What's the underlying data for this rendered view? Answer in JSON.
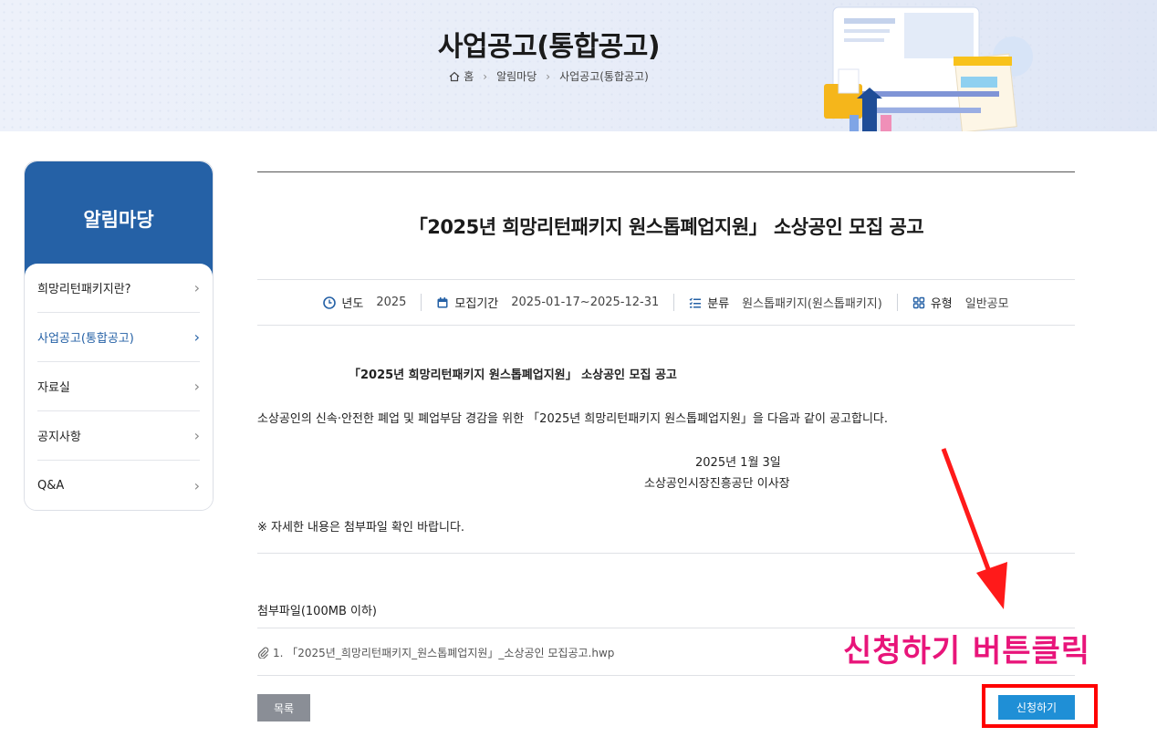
{
  "header": {
    "title": "사업공고(통합공고)",
    "breadcrumb": [
      "홈",
      "알림마당",
      "사업공고(통합공고)"
    ]
  },
  "sidebar": {
    "title": "알림마당",
    "items": [
      {
        "label": "희망리턴패키지란?",
        "active": false
      },
      {
        "label": "사업공고(통합공고)",
        "active": true
      },
      {
        "label": "자료실",
        "active": false
      },
      {
        "label": "공지사항",
        "active": false
      },
      {
        "label": "Q&A",
        "active": false
      }
    ]
  },
  "article": {
    "title": "「2025년 희망리턴패키지 원스톱폐업지원」 소상공인 모집 공고",
    "meta": [
      {
        "icon": "clock-icon",
        "key": "년도",
        "value": "2025"
      },
      {
        "icon": "calendar-icon",
        "key": "모집기간",
        "value": "2025-01-17~2025-12-31"
      },
      {
        "icon": "list-icon",
        "key": "분류",
        "value": "원스톱패키지(원스톱패키지)"
      },
      {
        "icon": "grid-icon",
        "key": "유형",
        "value": "일반공모"
      }
    ],
    "body_title": "「2025년 희망리턴패키지 원스톱폐업지원」 소상공인 모집 공고",
    "body_para": "소상공인의 신속·안전한 폐업 및 폐업부담 경감을 위한 「2025년 희망리턴패키지 원스톱폐업지원」을 다음과 같이 공고합니다.",
    "date": "2025년 1월 3일",
    "signature": "소상공인시장진흥공단 이사장",
    "note": "※ 자세한 내용은 첨부파일 확인 바랍니다.",
    "attachments_label": "첨부파일(100MB 이하)",
    "attachment_file": "1. 「2025년_희망리턴패키지_원스톱폐업지원」_소상공인 모집공고.hwp"
  },
  "buttons": {
    "list": "목록",
    "apply": "신청하기"
  },
  "annotation": {
    "text": "신청하기 버튼클릭",
    "color": "#e8157a",
    "box_color": "#ff0000"
  },
  "colors": {
    "primary": "#2561a6",
    "apply_button": "#1f8fd6"
  }
}
